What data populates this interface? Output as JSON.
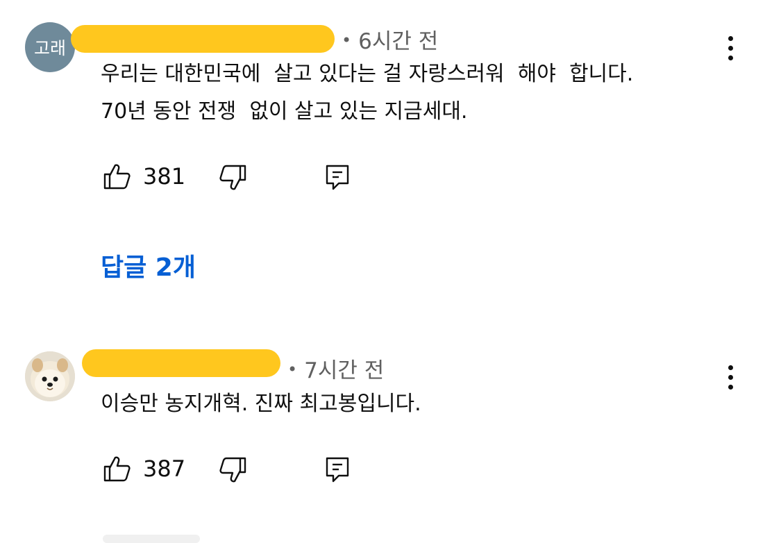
{
  "comments": [
    {
      "avatar_text": "고래",
      "avatar_icon": "user-avatar",
      "author_redacted": true,
      "time_text": "6시간 전",
      "lines": [
        "우리는 대한민국에  살고 있다는 걸 자랑스러워  해야  합니다.",
        "70년 동안 전쟁  없이 살고 있는 지금세대."
      ],
      "like_count": "381",
      "replies_label": "답글 2개"
    },
    {
      "avatar_icon": "pomeranian-dog-avatar",
      "author_redacted": true,
      "time_text": "7시간 전",
      "lines": [
        "이승만 농지개혁. 진짜 최고봉입니다."
      ],
      "like_count": "387"
    }
  ],
  "icons": {
    "like": "thumbs-up-icon",
    "dislike": "thumbs-down-icon",
    "reply": "comment-reply-icon",
    "more": "more-vertical-icon"
  },
  "colors": {
    "link": "#065fd4",
    "meta": "#606060",
    "redaction": "#ffc71e",
    "avatar_bg": "#6f8a9a"
  }
}
